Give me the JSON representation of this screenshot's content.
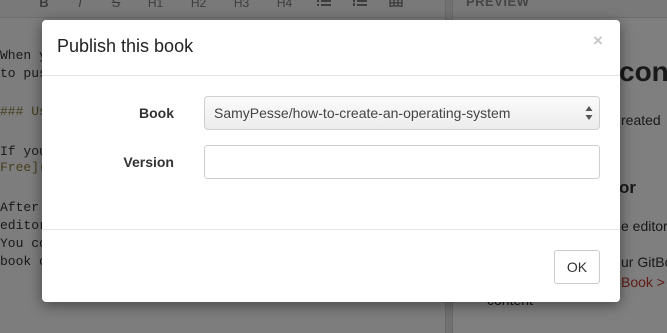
{
  "toolbar": {
    "items": [
      {
        "label": "B",
        "icon": "bold-icon"
      },
      {
        "label": "I",
        "icon": "italic-icon"
      },
      {
        "label": "S",
        "icon": "strikethrough-icon"
      },
      {
        "label": "H1"
      },
      {
        "label": "H2"
      },
      {
        "label": "H3"
      },
      {
        "label": "H4"
      },
      {
        "icon": "bulleted-list-icon"
      },
      {
        "icon": "numbered-list-icon"
      },
      {
        "icon": "table-icon"
      }
    ]
  },
  "editor": {
    "lines": [
      "When y",
      "to pus",
      "### Us",
      "If you",
      "Free](",
      "After",
      "editor",
      "You co",
      "book c"
    ]
  },
  "preview": {
    "tab_label": "PREVIEW",
    "heading": "cont",
    "text1": "reated",
    "subheading": "or",
    "text2": "e editor",
    "text3": "ur GitBo",
    "link": "Book >",
    "text4": "content"
  },
  "modal": {
    "title": "Publish this book",
    "close_label": "×",
    "book_label": "Book",
    "book_value": "SamyPesse/how-to-create-an-operating-system",
    "version_label": "Version",
    "version_value": "",
    "version_placeholder": "",
    "ok_label": "OK"
  },
  "colors": {
    "backdrop": "rgba(0,0,0,0.5)",
    "link": "#c0392b"
  }
}
